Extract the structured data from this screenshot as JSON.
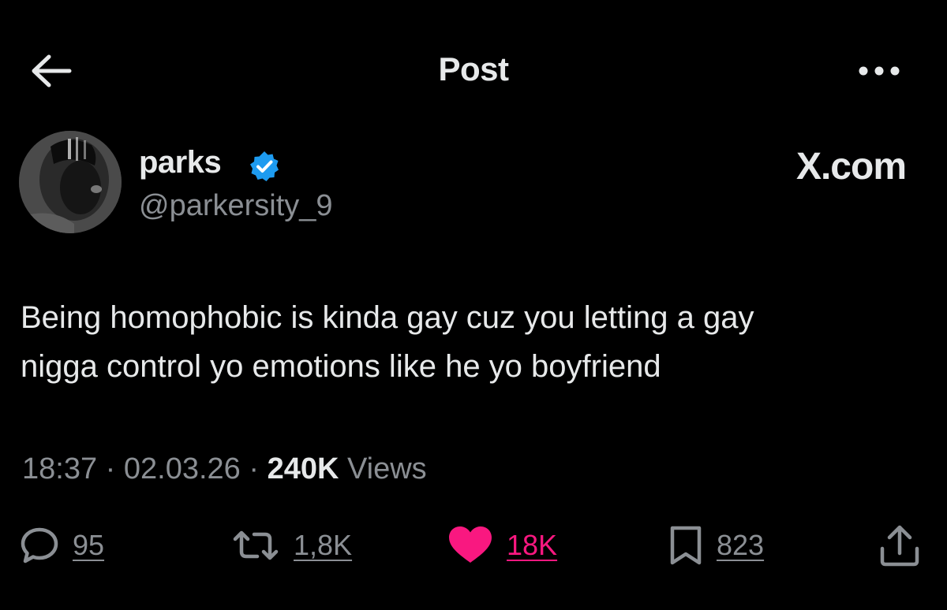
{
  "header": {
    "title": "Post",
    "back_icon": "arrow-left-icon",
    "more_icon": "more-horizontal-icon"
  },
  "author": {
    "name": "parks",
    "handle": "@parkersity_9",
    "verified": true,
    "verified_color": "#1d9bf0"
  },
  "watermark": "X.com",
  "tweet": {
    "text": "Being homophobic is kinda gay cuz you letting a gay\nnigga control yo emotions like he yo boyfriend"
  },
  "meta": {
    "time": "18:37",
    "sep1": " · ",
    "date": "02.03.26",
    "sep2": " · ",
    "views_count": "240K",
    "views_label": " Views"
  },
  "actions": {
    "replies": {
      "icon": "reply-icon",
      "count": "95"
    },
    "reposts": {
      "icon": "repost-icon",
      "count": "1,8K"
    },
    "likes": {
      "icon": "heart-icon",
      "count": "18K",
      "liked": true,
      "color": "#f91880"
    },
    "bookmarks": {
      "icon": "bookmark-icon",
      "count": "823"
    },
    "share": {
      "icon": "share-icon"
    }
  },
  "colors": {
    "background": "#000000",
    "text_primary": "#e7e9ea",
    "text_secondary": "#8b8f94",
    "like_pink": "#f91880",
    "verified_blue": "#1d9bf0"
  }
}
